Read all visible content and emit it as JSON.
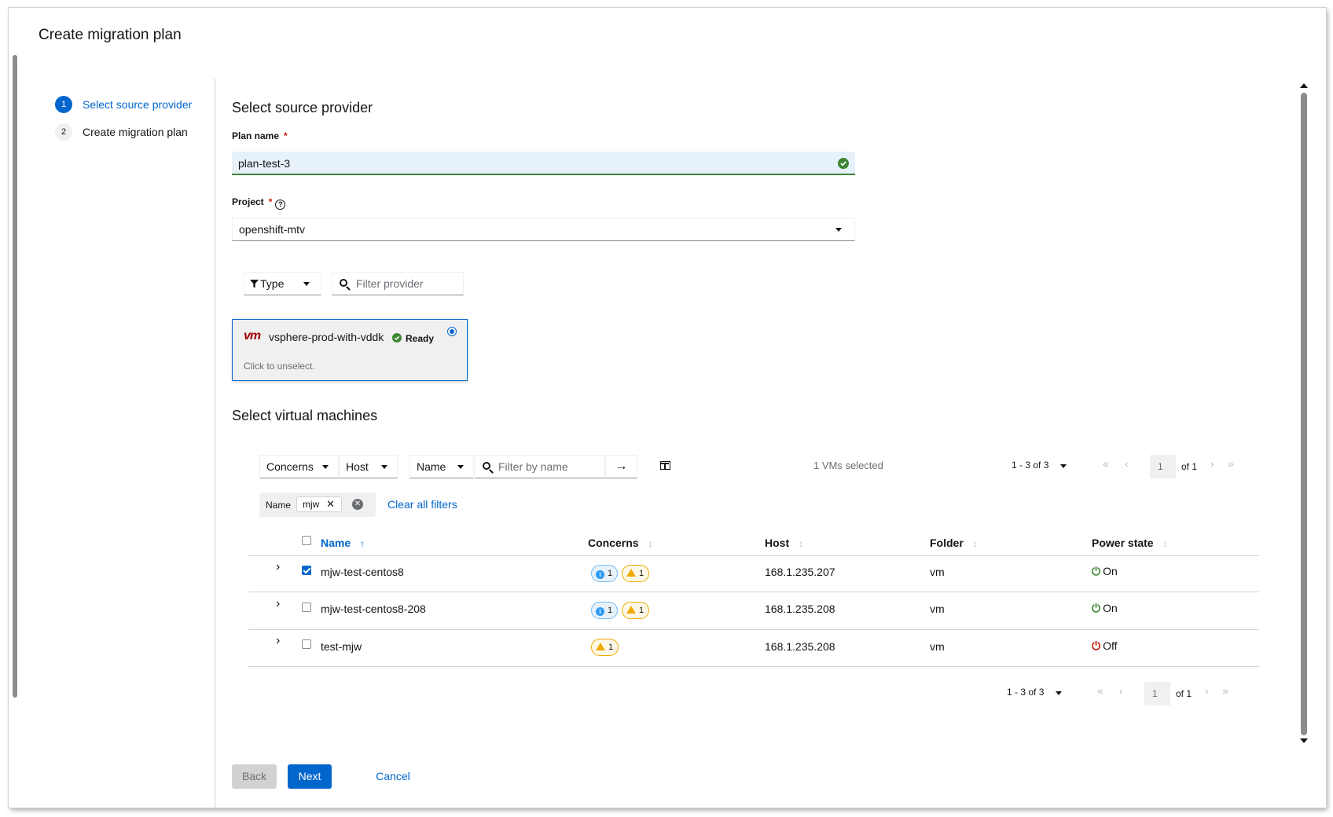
{
  "page": {
    "title": "Create migration plan"
  },
  "wizard": {
    "steps": [
      {
        "number": "1",
        "label": "Select source provider",
        "active": true
      },
      {
        "number": "2",
        "label": "Create migration plan",
        "active": false
      }
    ]
  },
  "source": {
    "title": "Select source provider",
    "plan_name_label": "Plan name",
    "required_mark": "*",
    "plan_name_value": "plan-test-3",
    "project_label": "Project",
    "project_value": "openshift-mtv",
    "help_glyph": "?"
  },
  "provider_filter": {
    "type_label": "Type",
    "search_placeholder": "Filter provider"
  },
  "provider_card": {
    "logo_text": "vm",
    "name": "vsphere-prod-with-vddk",
    "status": "Ready",
    "hint": "Click to unselect."
  },
  "vms": {
    "title": "Select virtual machines",
    "toolbar": {
      "concerns_filter": "Concerns",
      "host_filter": "Host",
      "name_filter": "Name",
      "search_placeholder": "Filter by name",
      "arrow": "→",
      "selected_count": "1 VMs selected"
    },
    "pagination": {
      "range": "1 - 3 of 3",
      "page": "1",
      "of": "of 1",
      "first": "«",
      "prev": "‹",
      "next": "›",
      "last": "»"
    },
    "active_filter": {
      "category": "Name",
      "value": "mjw",
      "remove": "✕",
      "clear_all": "Clear all filters"
    },
    "columns": {
      "name": "Name",
      "concerns": "Concerns",
      "host": "Host",
      "folder": "Folder",
      "power_state": "Power state"
    },
    "sort_glyphs": {
      "active": "↑",
      "inactive": "↕"
    },
    "rows": [
      {
        "name": "mjw-test-centos8",
        "checked": true,
        "info_count": "1",
        "warn_count": "1",
        "host": "168.1.235.207",
        "folder": "vm",
        "power": "On",
        "power_glyph": "⏻"
      },
      {
        "name": "mjw-test-centos8-208",
        "checked": false,
        "info_count": "1",
        "warn_count": "1",
        "host": "168.1.235.208",
        "folder": "vm",
        "power": "On",
        "power_glyph": "⏻"
      },
      {
        "name": "test-mjw",
        "checked": false,
        "info_count": null,
        "warn_count": "1",
        "host": "168.1.235.208",
        "folder": "vm",
        "power": "Off",
        "power_glyph": "⏻"
      }
    ],
    "expand_glyph": "›",
    "info_glyph": "i"
  },
  "footer": {
    "back_label": "Back",
    "next_label": "Next",
    "cancel_label": "Cancel"
  },
  "colors": {
    "primary": "#0066cc",
    "success": "#3e8635",
    "warning": "#f0ab00",
    "danger": "#c9190b",
    "info": "#2b9af3"
  }
}
